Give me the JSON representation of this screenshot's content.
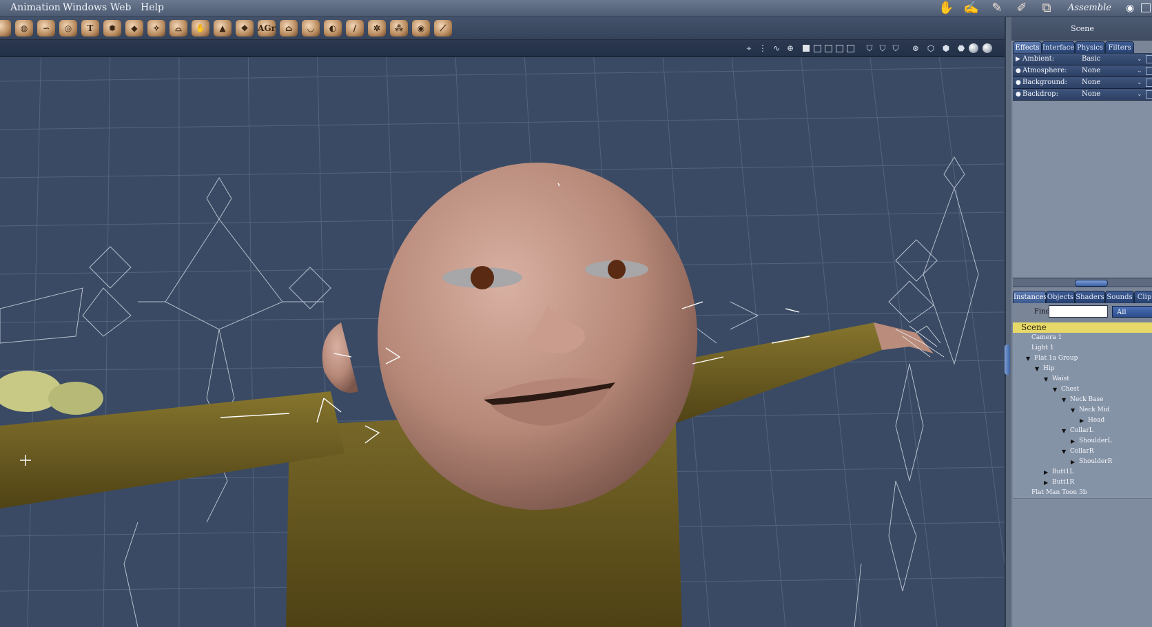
{
  "menu": {
    "items": [
      "Animation",
      "Windows",
      "Web",
      "Help"
    ]
  },
  "rooms": {
    "active_label": "Assemble",
    "icons": [
      "hand-room-icon",
      "pose-room-icon",
      "face-room-icon",
      "hair-room-icon",
      "cloth-room-icon"
    ]
  },
  "toolbar": {
    "tools": [
      {
        "name": "rotate-tool",
        "glyph": ""
      },
      {
        "name": "sphere-tool",
        "glyph": "◍"
      },
      {
        "name": "bone-joint-tool",
        "glyph": "∽"
      },
      {
        "name": "torus-tool",
        "glyph": "◎"
      },
      {
        "name": "text-tool",
        "glyph": "T"
      },
      {
        "name": "gear-tool",
        "glyph": "✹"
      },
      {
        "name": "plane-tool",
        "glyph": "◆"
      },
      {
        "name": "spring-tool",
        "glyph": "✧"
      },
      {
        "name": "hat-tool",
        "glyph": "⌓"
      },
      {
        "name": "hand-tool",
        "glyph": "✋"
      },
      {
        "name": "terrain-tool",
        "glyph": "▲"
      },
      {
        "name": "gem-tool",
        "glyph": "❖"
      },
      {
        "name": "agt-tool",
        "glyph": "AGr"
      },
      {
        "name": "house-tool",
        "glyph": "⌂"
      },
      {
        "name": "bowl-tool",
        "glyph": "◡"
      },
      {
        "name": "light-tool",
        "glyph": "◐"
      },
      {
        "name": "brush-tool",
        "glyph": "/"
      },
      {
        "name": "skeleton-tool",
        "glyph": "✲"
      },
      {
        "name": "hierarchy-tool",
        "glyph": "⁂"
      },
      {
        "name": "target-tool",
        "glyph": "◉"
      },
      {
        "name": "bone-tool",
        "glyph": "⟋"
      }
    ]
  },
  "scene_panel": {
    "title": "Scene",
    "top_tabs": [
      "Effects",
      "Interface",
      "Physics",
      "Filters"
    ],
    "effects": [
      {
        "label": "Ambient:",
        "value": "Basic",
        "marker": "▶"
      },
      {
        "label": "Atmosphere:",
        "value": "None",
        "marker": "●"
      },
      {
        "label": "Background:",
        "value": "None",
        "marker": "●"
      },
      {
        "label": "Backdrop:",
        "value": "None",
        "marker": "●"
      }
    ],
    "bottom_tabs": [
      "Instances",
      "Objects",
      "Shaders",
      "Sounds",
      "Clip"
    ],
    "find_label": "Find:",
    "find_value": "",
    "find_filter": "All",
    "tree": [
      {
        "label": "Scene",
        "depth": 0,
        "toggle": ""
      },
      {
        "label": "Camera 1",
        "depth": 1,
        "toggle": ""
      },
      {
        "label": "Light 1",
        "depth": 1,
        "toggle": ""
      },
      {
        "label": "Flat 1a Group",
        "depth": 1,
        "toggle": "▼"
      },
      {
        "label": "Hip",
        "depth": 2,
        "toggle": "▼"
      },
      {
        "label": "Waist",
        "depth": 3,
        "toggle": "▼"
      },
      {
        "label": "Chest",
        "depth": 4,
        "toggle": "▼"
      },
      {
        "label": "Neck Base",
        "depth": 5,
        "toggle": "▼"
      },
      {
        "label": "Neck Mid",
        "depth": 6,
        "toggle": "▼"
      },
      {
        "label": "Head",
        "depth": 7,
        "toggle": "▶"
      },
      {
        "label": "CollarL",
        "depth": 5,
        "toggle": "▼"
      },
      {
        "label": "ShoulderL",
        "depth": 6,
        "toggle": "▶"
      },
      {
        "label": "CollarR",
        "depth": 5,
        "toggle": "▼"
      },
      {
        "label": "ShoulderR",
        "depth": 6,
        "toggle": "▶"
      },
      {
        "label": "Butt1L",
        "depth": 3,
        "toggle": "▶"
      },
      {
        "label": "Butt1R",
        "depth": 3,
        "toggle": "▶"
      },
      {
        "label": "Flat Man Toon 3b",
        "depth": 1,
        "toggle": ""
      }
    ]
  },
  "colors": {
    "viewport_bg": "#3a4a64",
    "skin": "#c79c8c",
    "shirt": "#6b5a20",
    "tree_header": "#e6d869",
    "tab_blue": "#3d5b93"
  }
}
